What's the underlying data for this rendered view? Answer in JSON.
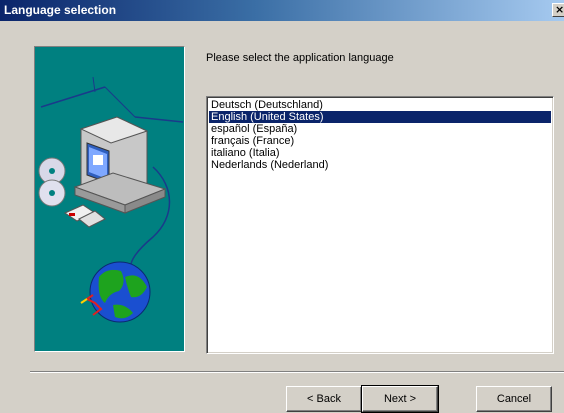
{
  "window": {
    "title": "Language selection",
    "close_symbol": "×"
  },
  "main": {
    "prompt": "Please select the application language",
    "languages": [
      {
        "label": "Deutsch (Deutschland)",
        "selected": false
      },
      {
        "label": "English (United States)",
        "selected": true
      },
      {
        "label": "español (España)",
        "selected": false
      },
      {
        "label": "français (France)",
        "selected": false
      },
      {
        "label": "italiano (Italia)",
        "selected": false
      },
      {
        "label": "Nederlands (Nederland)",
        "selected": false
      }
    ]
  },
  "buttons": {
    "back": "< Back",
    "next": "Next >",
    "cancel": "Cancel"
  },
  "colors": {
    "titlebar_start": "#0a246a",
    "selection": "#0a246a",
    "illustration_bg": "#008080",
    "dialog_bg": "#d4d0c8"
  },
  "icons": [
    "close-icon",
    "computer-icon",
    "cd-icon",
    "globe-icon",
    "floppy-icon"
  ]
}
